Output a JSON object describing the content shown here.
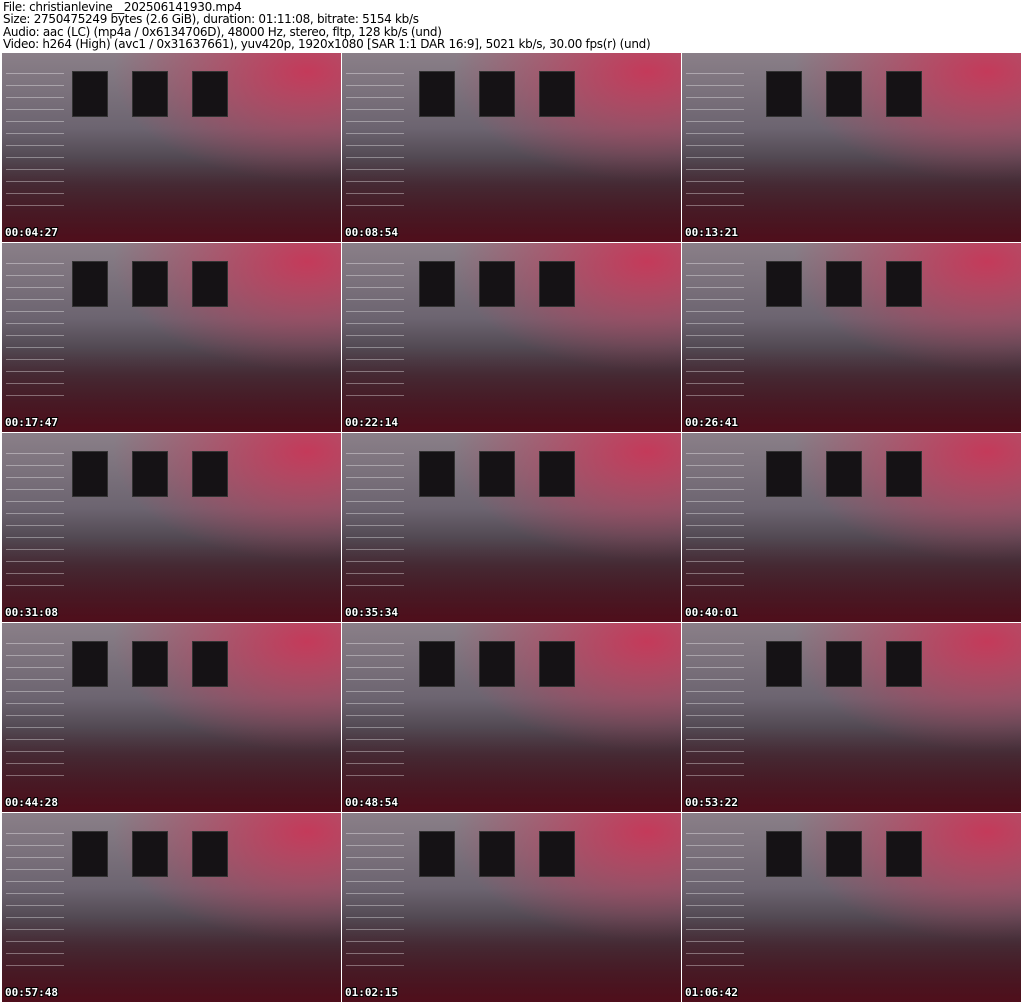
{
  "header": {
    "file": "File: christianlevine__202506141930.mp4",
    "size": "Size: 2750475249 bytes (2.6 GiB), duration: 01:11:08, bitrate: 5154 kb/s",
    "audio": "Audio: aac (LC) (mp4a / 0x6134706D), 48000 Hz, stereo, fltp, 128 kb/s (und)",
    "video": "Video: h264 (High) (avc1 / 0x31637661), yuv420p, 1920x1080 [SAR 1:1 DAR 16:9], 5021 kb/s, 30.00 fps(r) (und)"
  },
  "thumbnails": [
    {
      "timestamp": "00:04:27"
    },
    {
      "timestamp": "00:08:54"
    },
    {
      "timestamp": "00:13:21"
    },
    {
      "timestamp": "00:17:47"
    },
    {
      "timestamp": "00:22:14"
    },
    {
      "timestamp": "00:26:41"
    },
    {
      "timestamp": "00:31:08"
    },
    {
      "timestamp": "00:35:34"
    },
    {
      "timestamp": "00:40:01"
    },
    {
      "timestamp": "00:44:28"
    },
    {
      "timestamp": "00:48:54"
    },
    {
      "timestamp": "00:53:22"
    },
    {
      "timestamp": "00:57:48"
    },
    {
      "timestamp": "01:02:15"
    },
    {
      "timestamp": "01:06:42"
    }
  ]
}
